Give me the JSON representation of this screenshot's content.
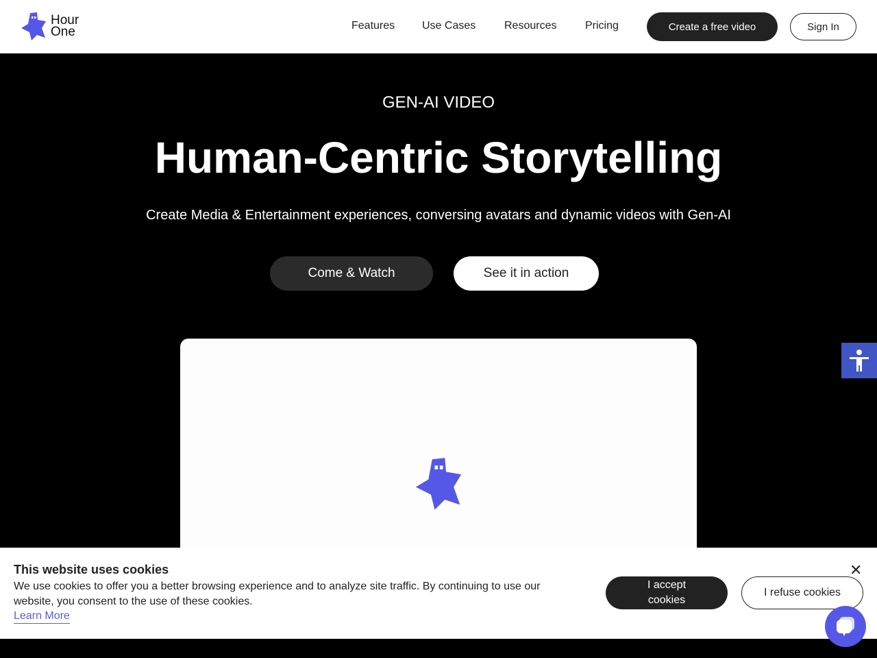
{
  "brand": {
    "name": "Hour One",
    "line1": "Hour",
    "line2": "One",
    "color": "#5558e6"
  },
  "nav": {
    "links": [
      "Features",
      "Use Cases",
      "Resources",
      "Pricing"
    ],
    "cta": "Create a free video",
    "signin": "Sign In"
  },
  "hero": {
    "eyebrow": "GEN-AI VIDEO",
    "title": "Human-Centric Storytelling",
    "subtitle": "Create Media & Entertainment experiences, conversing avatars and dynamic videos with Gen-AI",
    "primary": "Come & Watch",
    "secondary": "See it in action"
  },
  "cookie": {
    "title": "This website uses cookies",
    "body": "We use cookies to offer you a better browsing experience and to analyze site traffic. By continuing to use our website, you consent to the use of these cookies.",
    "learn_more": "Learn More",
    "accept": "I accept cookies",
    "refuse": "I refuse cookies"
  },
  "icons": {
    "accessibility": "accessibility-icon",
    "chat": "chat-icon",
    "close": "close-icon"
  }
}
